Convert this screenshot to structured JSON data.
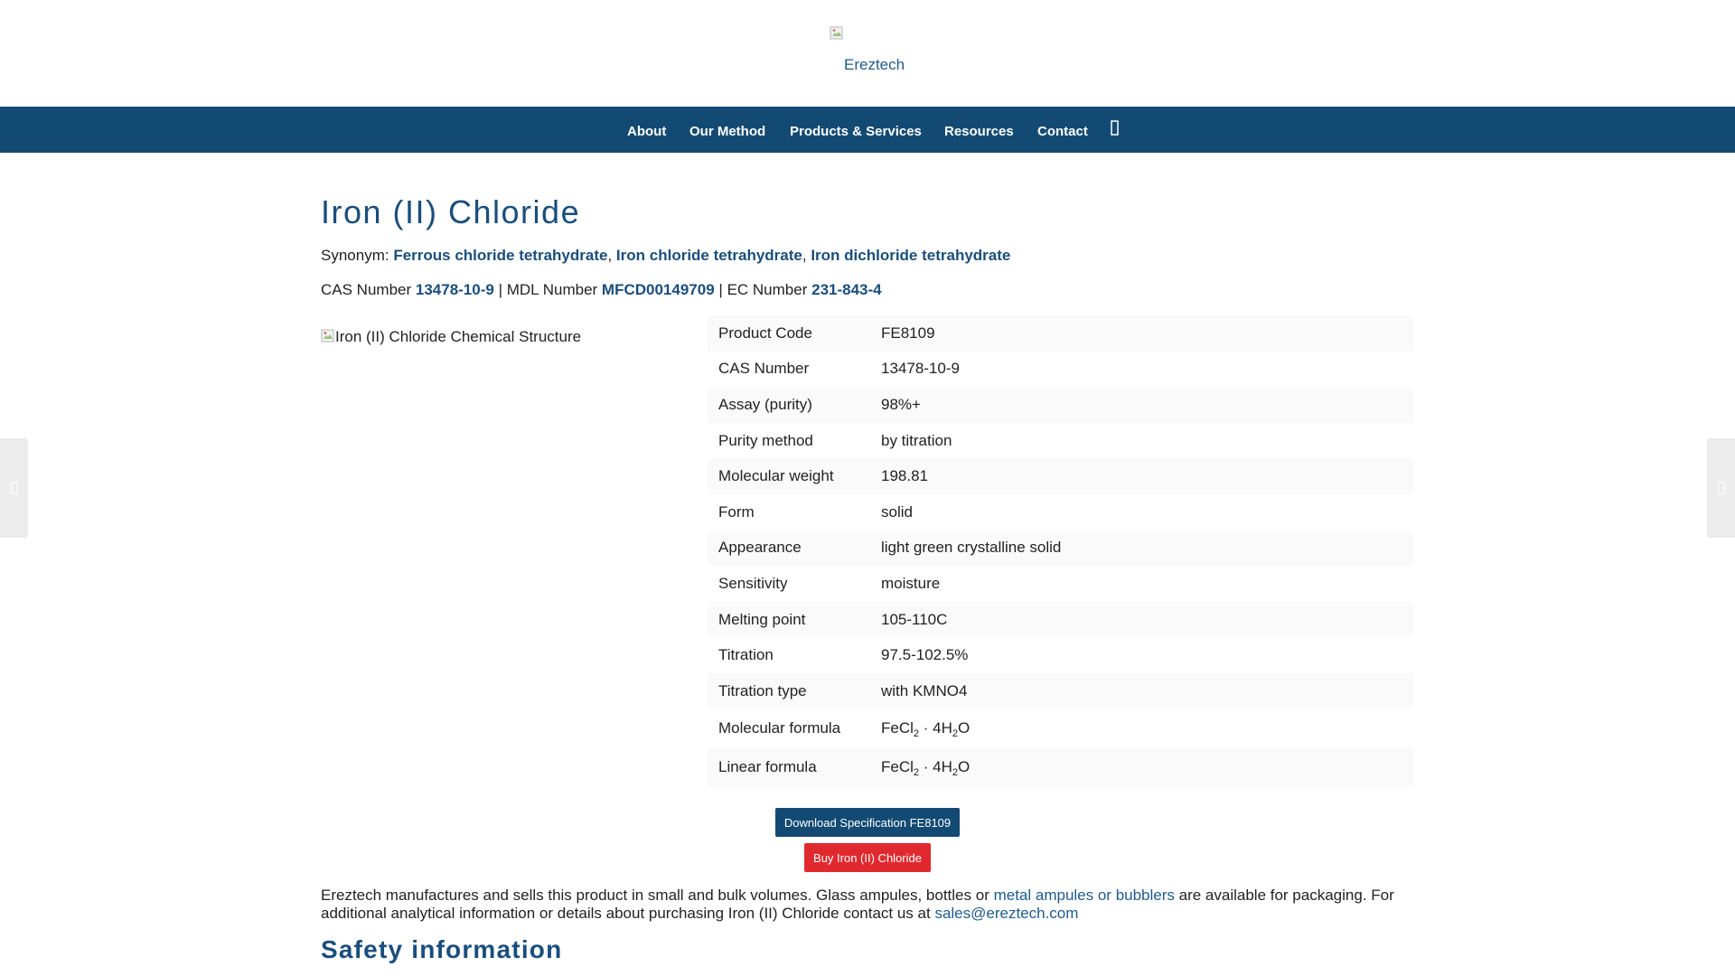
{
  "header": {
    "logo_alt": "Ereztech"
  },
  "nav": {
    "items": [
      {
        "label": "About"
      },
      {
        "label": "Our Method"
      },
      {
        "label": "Products & Services"
      },
      {
        "label": "Resources"
      },
      {
        "label": "Contact"
      }
    ],
    "search_icon": "search-icon"
  },
  "product": {
    "title": "Iron (II) Chloride",
    "synonym_label": "Synonym:",
    "synonyms": [
      "Ferrous chloride tetrahydrate",
      "Iron chloride tetrahydrate",
      "Iron dichloride tetrahydrate"
    ],
    "separator": ",",
    "cas_label": "CAS Number",
    "cas_value": "13478-10-9",
    "pipe": "|",
    "mdl_label": "MDL Number",
    "mdl_value": "MFCD00149709",
    "ec_label": "EC Number",
    "ec_value": "231-843-4",
    "structure_alt": "Iron (II) Chloride Chemical Structure"
  },
  "spec_table": {
    "rows": [
      {
        "key": "Product Code",
        "value": "FE8109"
      },
      {
        "key": "CAS Number",
        "value": "13478-10-9"
      },
      {
        "key": "Assay (purity)",
        "value": "98%+"
      },
      {
        "key": "Purity method",
        "value": "by titration"
      },
      {
        "key": "Molecular weight",
        "value": "198.81"
      },
      {
        "key": "Form",
        "value": "solid"
      },
      {
        "key": "Appearance",
        "value": "light green crystalline solid"
      },
      {
        "key": "Sensitivity",
        "value": "moisture"
      },
      {
        "key": "Melting point",
        "value": "105-110C"
      },
      {
        "key": "Titration",
        "value": "97.5-102.5%"
      },
      {
        "key": "Titration type",
        "value": "with KMNO4"
      }
    ],
    "formula_rows": [
      {
        "key": "Molecular formula",
        "v1": "FeCl",
        "s1": "2",
        "v2": " · 4H",
        "s2": "2",
        "v3": "O"
      },
      {
        "key": "Linear formula",
        "v1": "FeCl",
        "s1": "2",
        "v2": " · 4H",
        "s2": "2",
        "v3": "O"
      }
    ]
  },
  "buttons": {
    "download_label": "Download Specification FE8109",
    "buy_label": "Buy Iron (II) Chloride"
  },
  "description": {
    "part1": "Ereztech manufactures and sells this product in small and bulk volumes. Glass ampules, bottles or ",
    "link1": "metal ampules or bubblers",
    "part2": " are available for packaging. For additional analytical information or details about purchasing Iron (II) Chloride contact us at ",
    "email": "sales@ereztech.com"
  },
  "safety": {
    "heading": "Safety information"
  },
  "colors": {
    "brand_blue": "#134a73",
    "link_blue": "#1a4e7d",
    "buy_red": "#e0292f"
  }
}
